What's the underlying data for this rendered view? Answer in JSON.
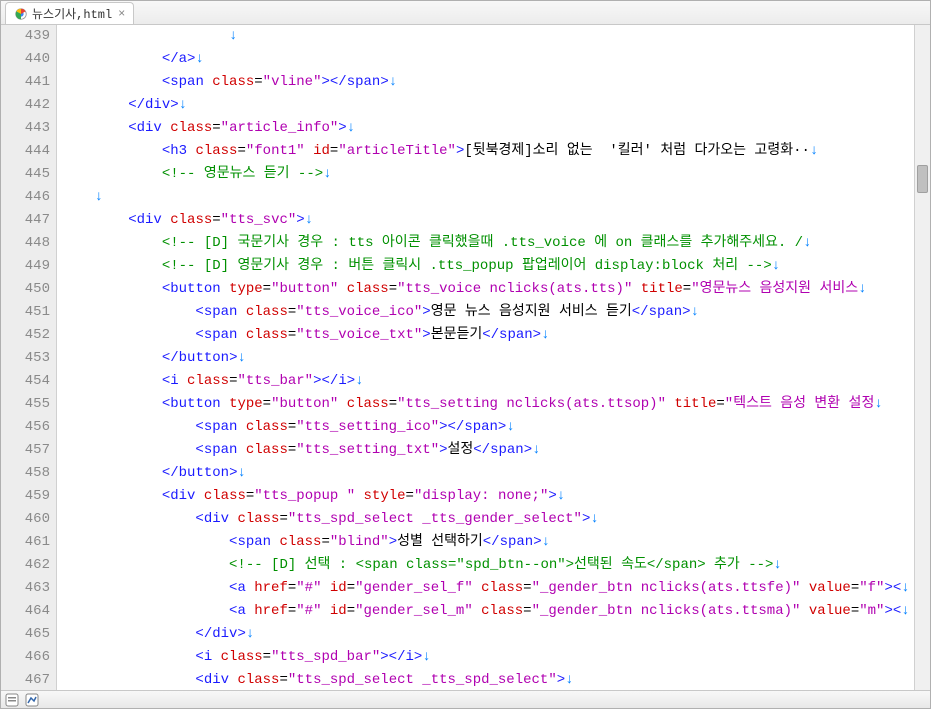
{
  "tab": {
    "title": "뉴스기사,html",
    "close": "×"
  },
  "newline_glyph": "↵",
  "gutter": [
    "439",
    "440",
    "441",
    "442",
    "443",
    "444",
    "445",
    "446",
    "447",
    "448",
    "449",
    "450",
    "451",
    "452",
    "453",
    "454",
    "455",
    "456",
    "457",
    "458",
    "459",
    "460",
    "461",
    "462",
    "463",
    "464",
    "465",
    "466",
    "467"
  ],
  "lines": [
    {
      "indent": 20,
      "parts": []
    },
    {
      "indent": 12,
      "parts": [
        {
          "k": "angle",
          "t": "</"
        },
        {
          "k": "tag",
          "t": "a"
        },
        {
          "k": "angle",
          "t": ">"
        }
      ]
    },
    {
      "indent": 12,
      "parts": [
        {
          "k": "angle",
          "t": "<"
        },
        {
          "k": "tag",
          "t": "span"
        },
        {
          "k": "text",
          "t": " "
        },
        {
          "k": "attr",
          "t": "class"
        },
        {
          "k": "eq",
          "t": "="
        },
        {
          "k": "str",
          "t": "\"vline\""
        },
        {
          "k": "angle",
          "t": "></"
        },
        {
          "k": "tag",
          "t": "span"
        },
        {
          "k": "angle",
          "t": ">"
        }
      ]
    },
    {
      "indent": 8,
      "parts": [
        {
          "k": "angle",
          "t": "</"
        },
        {
          "k": "tag",
          "t": "div"
        },
        {
          "k": "angle",
          "t": ">"
        }
      ]
    },
    {
      "indent": 8,
      "parts": [
        {
          "k": "angle",
          "t": "<"
        },
        {
          "k": "tag",
          "t": "div"
        },
        {
          "k": "text",
          "t": " "
        },
        {
          "k": "attr",
          "t": "class"
        },
        {
          "k": "eq",
          "t": "="
        },
        {
          "k": "str",
          "t": "\"article_info\""
        },
        {
          "k": "angle",
          "t": ">"
        }
      ]
    },
    {
      "indent": 12,
      "parts": [
        {
          "k": "angle",
          "t": "<"
        },
        {
          "k": "tag",
          "t": "h3"
        },
        {
          "k": "text",
          "t": " "
        },
        {
          "k": "attr",
          "t": "class"
        },
        {
          "k": "eq",
          "t": "="
        },
        {
          "k": "str",
          "t": "\"font1\""
        },
        {
          "k": "text",
          "t": " "
        },
        {
          "k": "attr",
          "t": "id"
        },
        {
          "k": "eq",
          "t": "="
        },
        {
          "k": "str",
          "t": "\"articleTitle\""
        },
        {
          "k": "angle",
          "t": ">"
        },
        {
          "k": "text",
          "t": "[뒷북경제]소리 없는  '킬러' 처럼 다가오는 고령화··"
        }
      ]
    },
    {
      "indent": 12,
      "parts": [
        {
          "k": "comment",
          "t": "<!-- 영문뉴스 듣기 -->"
        }
      ]
    },
    {
      "indent": 4,
      "parts": []
    },
    {
      "indent": 8,
      "parts": [
        {
          "k": "angle",
          "t": "<"
        },
        {
          "k": "tag",
          "t": "div"
        },
        {
          "k": "text",
          "t": " "
        },
        {
          "k": "attr",
          "t": "class"
        },
        {
          "k": "eq",
          "t": "="
        },
        {
          "k": "str",
          "t": "\"tts_svc\""
        },
        {
          "k": "angle",
          "t": ">"
        }
      ]
    },
    {
      "indent": 12,
      "parts": [
        {
          "k": "comment",
          "t": "<!-- [D] 국문기사 경우 : tts 아이콘 클릭했을때 .tts_voice 에 on 클래스를 추가해주세요. /"
        }
      ]
    },
    {
      "indent": 12,
      "parts": [
        {
          "k": "comment",
          "t": "<!-- [D] 영문기사 경우 : 버튼 클릭시 .tts_popup 팝업레이어 display:block 처리 -->"
        }
      ]
    },
    {
      "indent": 12,
      "parts": [
        {
          "k": "angle",
          "t": "<"
        },
        {
          "k": "tag",
          "t": "button"
        },
        {
          "k": "text",
          "t": " "
        },
        {
          "k": "attr",
          "t": "type"
        },
        {
          "k": "eq",
          "t": "="
        },
        {
          "k": "str",
          "t": "\"button\""
        },
        {
          "k": "text",
          "t": " "
        },
        {
          "k": "attr",
          "t": "class"
        },
        {
          "k": "eq",
          "t": "="
        },
        {
          "k": "str",
          "t": "\"tts_voice nclicks(ats.tts)\""
        },
        {
          "k": "text",
          "t": " "
        },
        {
          "k": "attr",
          "t": "title"
        },
        {
          "k": "eq",
          "t": "="
        },
        {
          "k": "str",
          "t": "\"영문뉴스 음성지원 서비스"
        }
      ]
    },
    {
      "indent": 16,
      "parts": [
        {
          "k": "angle",
          "t": "<"
        },
        {
          "k": "tag",
          "t": "span"
        },
        {
          "k": "text",
          "t": " "
        },
        {
          "k": "attr",
          "t": "class"
        },
        {
          "k": "eq",
          "t": "="
        },
        {
          "k": "str",
          "t": "\"tts_voice_ico\""
        },
        {
          "k": "angle",
          "t": ">"
        },
        {
          "k": "text",
          "t": "영문 뉴스 음성지원 서비스 듣기"
        },
        {
          "k": "angle",
          "t": "</"
        },
        {
          "k": "tag",
          "t": "span"
        },
        {
          "k": "angle",
          "t": ">"
        }
      ]
    },
    {
      "indent": 16,
      "parts": [
        {
          "k": "angle",
          "t": "<"
        },
        {
          "k": "tag",
          "t": "span"
        },
        {
          "k": "text",
          "t": " "
        },
        {
          "k": "attr",
          "t": "class"
        },
        {
          "k": "eq",
          "t": "="
        },
        {
          "k": "str",
          "t": "\"tts_voice_txt\""
        },
        {
          "k": "angle",
          "t": ">"
        },
        {
          "k": "text",
          "t": "본문듣기"
        },
        {
          "k": "angle",
          "t": "</"
        },
        {
          "k": "tag",
          "t": "span"
        },
        {
          "k": "angle",
          "t": ">"
        }
      ]
    },
    {
      "indent": 12,
      "parts": [
        {
          "k": "angle",
          "t": "</"
        },
        {
          "k": "tag",
          "t": "button"
        },
        {
          "k": "angle",
          "t": ">"
        }
      ]
    },
    {
      "indent": 12,
      "parts": [
        {
          "k": "angle",
          "t": "<"
        },
        {
          "k": "tag",
          "t": "i"
        },
        {
          "k": "text",
          "t": " "
        },
        {
          "k": "attr",
          "t": "class"
        },
        {
          "k": "eq",
          "t": "="
        },
        {
          "k": "str",
          "t": "\"tts_bar\""
        },
        {
          "k": "angle",
          "t": "></"
        },
        {
          "k": "tag",
          "t": "i"
        },
        {
          "k": "angle",
          "t": ">"
        }
      ]
    },
    {
      "indent": 12,
      "parts": [
        {
          "k": "angle",
          "t": "<"
        },
        {
          "k": "tag",
          "t": "button"
        },
        {
          "k": "text",
          "t": " "
        },
        {
          "k": "attr",
          "t": "type"
        },
        {
          "k": "eq",
          "t": "="
        },
        {
          "k": "str",
          "t": "\"button\""
        },
        {
          "k": "text",
          "t": " "
        },
        {
          "k": "attr",
          "t": "class"
        },
        {
          "k": "eq",
          "t": "="
        },
        {
          "k": "str",
          "t": "\"tts_setting nclicks(ats.ttsop)\""
        },
        {
          "k": "text",
          "t": " "
        },
        {
          "k": "attr",
          "t": "title"
        },
        {
          "k": "eq",
          "t": "="
        },
        {
          "k": "str",
          "t": "\"텍스트 음성 변환 설정"
        }
      ]
    },
    {
      "indent": 16,
      "parts": [
        {
          "k": "angle",
          "t": "<"
        },
        {
          "k": "tag",
          "t": "span"
        },
        {
          "k": "text",
          "t": " "
        },
        {
          "k": "attr",
          "t": "class"
        },
        {
          "k": "eq",
          "t": "="
        },
        {
          "k": "str",
          "t": "\"tts_setting_ico\""
        },
        {
          "k": "angle",
          "t": "></"
        },
        {
          "k": "tag",
          "t": "span"
        },
        {
          "k": "angle",
          "t": ">"
        }
      ]
    },
    {
      "indent": 16,
      "parts": [
        {
          "k": "angle",
          "t": "<"
        },
        {
          "k": "tag",
          "t": "span"
        },
        {
          "k": "text",
          "t": " "
        },
        {
          "k": "attr",
          "t": "class"
        },
        {
          "k": "eq",
          "t": "="
        },
        {
          "k": "str",
          "t": "\"tts_setting_txt\""
        },
        {
          "k": "angle",
          "t": ">"
        },
        {
          "k": "text",
          "t": "설정"
        },
        {
          "k": "angle",
          "t": "</"
        },
        {
          "k": "tag",
          "t": "span"
        },
        {
          "k": "angle",
          "t": ">"
        }
      ]
    },
    {
      "indent": 12,
      "parts": [
        {
          "k": "angle",
          "t": "</"
        },
        {
          "k": "tag",
          "t": "button"
        },
        {
          "k": "angle",
          "t": ">"
        }
      ]
    },
    {
      "indent": 12,
      "parts": [
        {
          "k": "angle",
          "t": "<"
        },
        {
          "k": "tag",
          "t": "div"
        },
        {
          "k": "text",
          "t": " "
        },
        {
          "k": "attr",
          "t": "class"
        },
        {
          "k": "eq",
          "t": "="
        },
        {
          "k": "str",
          "t": "\"tts_popup \""
        },
        {
          "k": "text",
          "t": " "
        },
        {
          "k": "attr",
          "t": "style"
        },
        {
          "k": "eq",
          "t": "="
        },
        {
          "k": "str",
          "t": "\"display: none;\""
        },
        {
          "k": "angle",
          "t": ">"
        }
      ]
    },
    {
      "indent": 16,
      "parts": [
        {
          "k": "angle",
          "t": "<"
        },
        {
          "k": "tag",
          "t": "div"
        },
        {
          "k": "text",
          "t": " "
        },
        {
          "k": "attr",
          "t": "class"
        },
        {
          "k": "eq",
          "t": "="
        },
        {
          "k": "str",
          "t": "\"tts_spd_select _tts_gender_select\""
        },
        {
          "k": "angle",
          "t": ">"
        }
      ]
    },
    {
      "indent": 20,
      "parts": [
        {
          "k": "angle",
          "t": "<"
        },
        {
          "k": "tag",
          "t": "span"
        },
        {
          "k": "text",
          "t": " "
        },
        {
          "k": "attr",
          "t": "class"
        },
        {
          "k": "eq",
          "t": "="
        },
        {
          "k": "str",
          "t": "\"blind\""
        },
        {
          "k": "angle",
          "t": ">"
        },
        {
          "k": "text",
          "t": "성별 선택하기"
        },
        {
          "k": "angle",
          "t": "</"
        },
        {
          "k": "tag",
          "t": "span"
        },
        {
          "k": "angle",
          "t": ">"
        }
      ]
    },
    {
      "indent": 20,
      "parts": [
        {
          "k": "comment",
          "t": "<!-- [D] 선택 : <span class=\"spd_btn--on\">선택된 속도</span> 추가 -->"
        }
      ]
    },
    {
      "indent": 20,
      "parts": [
        {
          "k": "angle",
          "t": "<"
        },
        {
          "k": "tag",
          "t": "a"
        },
        {
          "k": "text",
          "t": " "
        },
        {
          "k": "attr",
          "t": "href"
        },
        {
          "k": "eq",
          "t": "="
        },
        {
          "k": "str",
          "t": "\"#\""
        },
        {
          "k": "text",
          "t": " "
        },
        {
          "k": "attr",
          "t": "id"
        },
        {
          "k": "eq",
          "t": "="
        },
        {
          "k": "str",
          "t": "\"gender_sel_f\""
        },
        {
          "k": "text",
          "t": " "
        },
        {
          "k": "attr",
          "t": "class"
        },
        {
          "k": "eq",
          "t": "="
        },
        {
          "k": "str",
          "t": "\"_gender_btn nclicks(ats.ttsfe)\""
        },
        {
          "k": "text",
          "t": " "
        },
        {
          "k": "attr",
          "t": "value"
        },
        {
          "k": "eq",
          "t": "="
        },
        {
          "k": "str",
          "t": "\"f\""
        },
        {
          "k": "angle",
          "t": "><"
        }
      ]
    },
    {
      "indent": 20,
      "parts": [
        {
          "k": "angle",
          "t": "<"
        },
        {
          "k": "tag",
          "t": "a"
        },
        {
          "k": "text",
          "t": " "
        },
        {
          "k": "attr",
          "t": "href"
        },
        {
          "k": "eq",
          "t": "="
        },
        {
          "k": "str",
          "t": "\"#\""
        },
        {
          "k": "text",
          "t": " "
        },
        {
          "k": "attr",
          "t": "id"
        },
        {
          "k": "eq",
          "t": "="
        },
        {
          "k": "str",
          "t": "\"gender_sel_m\""
        },
        {
          "k": "text",
          "t": " "
        },
        {
          "k": "attr",
          "t": "class"
        },
        {
          "k": "eq",
          "t": "="
        },
        {
          "k": "str",
          "t": "\"_gender_btn nclicks(ats.ttsma)\""
        },
        {
          "k": "text",
          "t": " "
        },
        {
          "k": "attr",
          "t": "value"
        },
        {
          "k": "eq",
          "t": "="
        },
        {
          "k": "str",
          "t": "\"m\""
        },
        {
          "k": "angle",
          "t": "><"
        }
      ]
    },
    {
      "indent": 16,
      "parts": [
        {
          "k": "angle",
          "t": "</"
        },
        {
          "k": "tag",
          "t": "div"
        },
        {
          "k": "angle",
          "t": ">"
        }
      ]
    },
    {
      "indent": 16,
      "parts": [
        {
          "k": "angle",
          "t": "<"
        },
        {
          "k": "tag",
          "t": "i"
        },
        {
          "k": "text",
          "t": " "
        },
        {
          "k": "attr",
          "t": "class"
        },
        {
          "k": "eq",
          "t": "="
        },
        {
          "k": "str",
          "t": "\"tts_spd_bar\""
        },
        {
          "k": "angle",
          "t": "></"
        },
        {
          "k": "tag",
          "t": "i"
        },
        {
          "k": "angle",
          "t": ">"
        }
      ]
    },
    {
      "indent": 16,
      "parts": [
        {
          "k": "angle",
          "t": "<"
        },
        {
          "k": "tag",
          "t": "div"
        },
        {
          "k": "text",
          "t": " "
        },
        {
          "k": "attr",
          "t": "class"
        },
        {
          "k": "eq",
          "t": "="
        },
        {
          "k": "str",
          "t": "\"tts_spd_select _tts_spd_select\""
        },
        {
          "k": "angle",
          "t": ">"
        }
      ]
    }
  ]
}
